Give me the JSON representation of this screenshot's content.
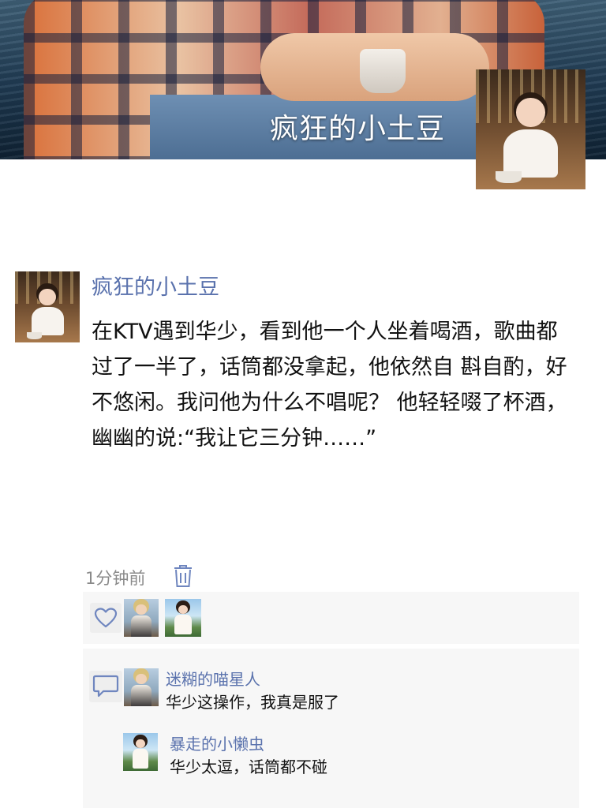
{
  "cover": {
    "username": "疯狂的小土豆"
  },
  "post": {
    "author": "疯狂的小土豆",
    "content": "在KTV遇到华少，看到他一个人坐着喝酒，歌曲都过了一半了，话筒都没拿起，他依然自 斟自酌，好不悠闲。我问他为什么不唱呢？ 他轻轻啜了杯酒，幽幽的说:“我让它三分钟……”",
    "time": "1分钟前"
  },
  "likes": {
    "icon": "heart-icon"
  },
  "comments": [
    {
      "author": "迷糊的喵星人",
      "text": "华少这操作，我真是服了"
    },
    {
      "author": "暴走的小懒虫",
      "text": "华少太逗，话筒都不碰"
    }
  ],
  "colors": {
    "link": "#5a72ad",
    "icon": "#6f86bf",
    "panel": "#f7f7f7"
  }
}
